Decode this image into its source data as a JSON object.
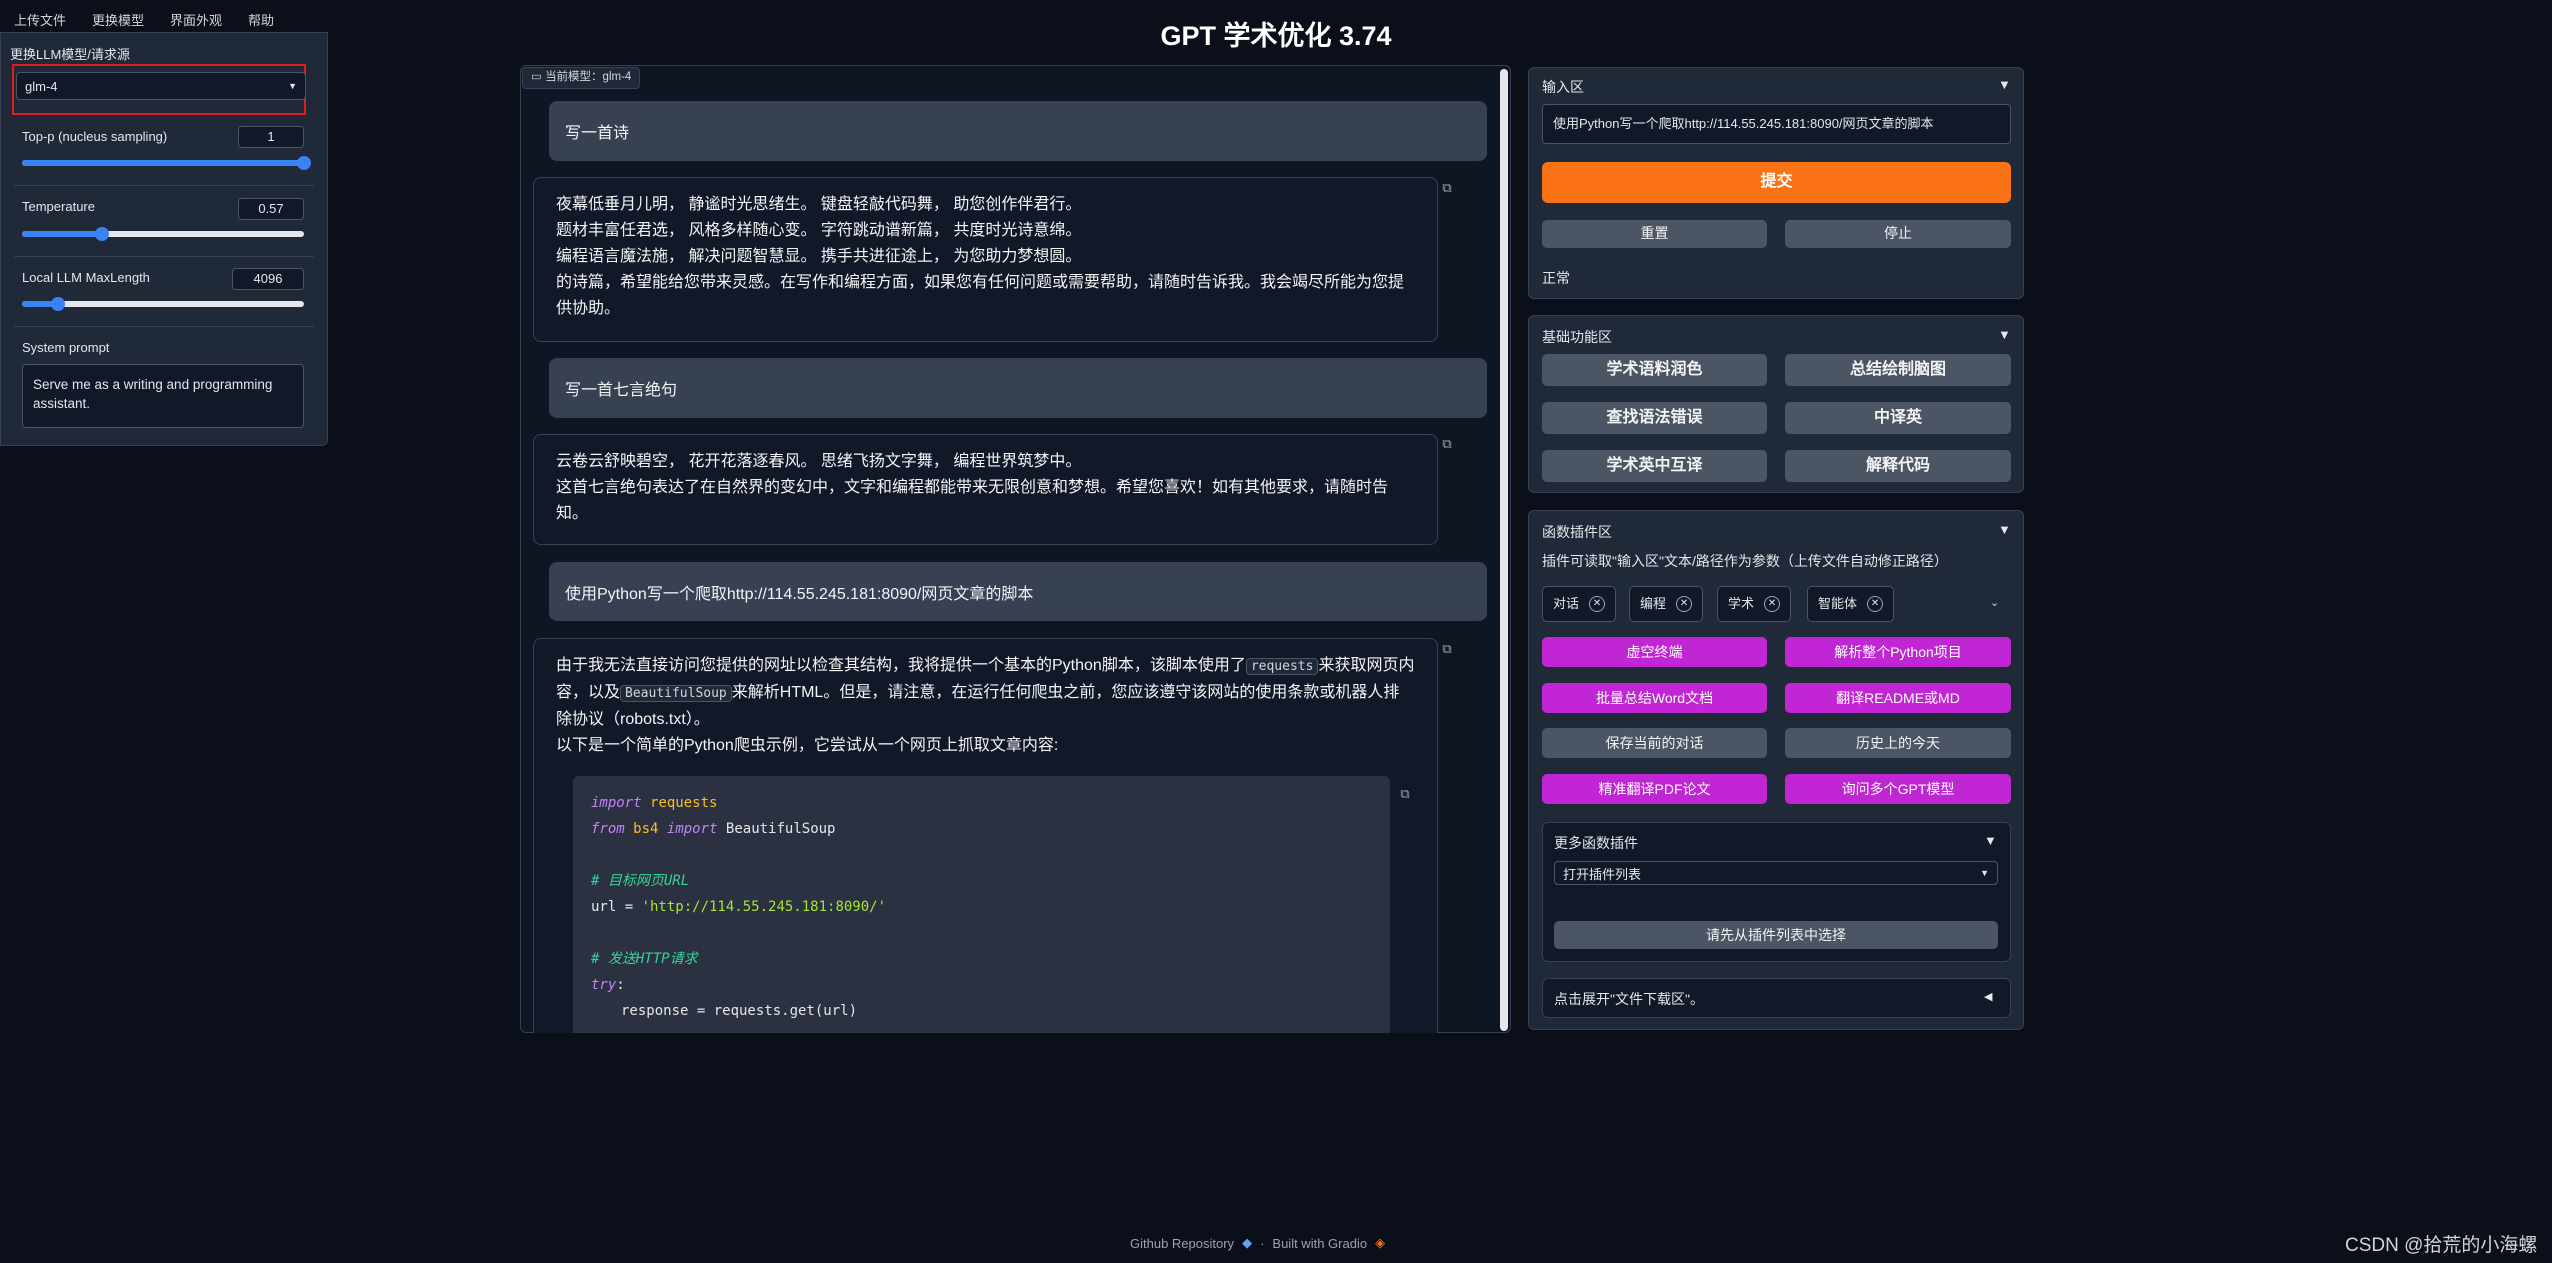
{
  "menu": [
    "上传文件",
    "更换模型",
    "界面外观",
    "帮助"
  ],
  "title": "GPT 学术优化 3.74",
  "left": {
    "model_label": "更换LLM模型/请求源",
    "model_value": "glm-4",
    "top_p": {
      "label": "Top-p (nucleus sampling)",
      "value": "1",
      "fraction": 1.0
    },
    "temperature": {
      "label": "Temperature",
      "value": "0.57",
      "fraction": 0.285
    },
    "maxlength": {
      "label": "Local LLM MaxLength",
      "value": "4096",
      "fraction": 0.128
    },
    "system_prompt_label": "System prompt",
    "system_prompt_value": "Serve me as a writing and programming assistant."
  },
  "chat": {
    "model_tag": "当前模型：glm-4",
    "messages": [
      {
        "role": "user",
        "text": "写一首诗"
      },
      {
        "role": "bot",
        "lines": [
          "夜幕低垂月儿明，  静谧时光思绪生。 键盘轻敲代码舞，  助您创作伴君行。",
          "题材丰富任君选，  风格多样随心变。 字符跳动谱新篇，  共度时光诗意绵。",
          "编程语言魔法施，  解决问题智慧显。 携手共进征途上，  为您助力梦想圆。",
          "的诗篇，希望能给您带来灵感。在写作和编程方面，如果您有任何问题或需要帮助，请随时告诉我。我会竭尽所能为您提供协助。"
        ]
      },
      {
        "role": "user",
        "text": "写一首七言绝句"
      },
      {
        "role": "bot",
        "lines": [
          "云卷云舒映碧空，  花开花落逐春风。 思绪飞扬文字舞，  编程世界筑梦中。",
          "这首七言绝句表达了在自然界的变幻中，文字和编程都能带来无限创意和梦想。希望您喜欢！如有其他要求，请随时告知。"
        ]
      },
      {
        "role": "user",
        "text": "使用Python写一个爬取http://114.55.245.181:8090/网页文章的脚本"
      },
      {
        "role": "bot",
        "p1_a": "由于我无法直接访问您提供的网址以检查其结构，我将提供一个基本的Python脚本，该脚本使用了",
        "code1": "requests",
        "p1_b": "来获取网页内容，以及",
        "code2": "BeautifulSoup",
        "p1_c": "来解析HTML。但是，请注意，在运行任何爬虫之前，您应该遵守该网站的使用条款或机器人排除协议（robots.txt）。",
        "p2": "以下是一个简单的Python爬虫示例，它尝试从一个网页上抓取文章内容:",
        "code": {
          "l1_kw": "import",
          "l1_rest": "requests",
          "l2_kw": "from",
          "l2_mod": "bs4",
          "l2_kw2": "import",
          "l2_rest": "BeautifulSoup",
          "c1": "# 目标网页URL",
          "url_line_a": "url = ",
          "url_line_str": "'http://114.55.245.181:8090/'",
          "c2": "# 发送HTTP请求",
          "try_kw": "try",
          "resp_line": "response = requests.get(url)"
        }
      }
    ]
  },
  "input_box": {
    "title": "输入区",
    "value": "使用Python写一个爬取http://114.55.245.181:8090/网页文章的脚本",
    "submit": "提交",
    "reset": "重置",
    "stop": "停止",
    "status": "正常"
  },
  "basic": {
    "title": "基础功能区",
    "buttons": [
      "学术语料润色",
      "总结绘制脑图",
      "查找语法错误",
      "中译英",
      "学术英中互译",
      "解释代码"
    ]
  },
  "plugins": {
    "title": "函数插件区",
    "hint": "插件可读取\"输入区\"文本/路径作为参数（上传文件自动修正路径）",
    "chips": [
      "对话",
      "编程",
      "学术",
      "智能体"
    ],
    "buttons": [
      "虚空终端",
      "解析整个Python项目",
      "批量总结Word文档",
      "翻译README或MD",
      "保存当前的对话",
      "历史上的今天",
      "精准翻译PDF论文",
      "询问多个GPT模型"
    ],
    "more_title": "更多函数插件",
    "dropdown": "打开插件列表",
    "select_btn": "请先从插件列表中选择",
    "download": "点击展开\"文件下载区\"。"
  },
  "footer": {
    "github": "Github Repository",
    "gradio": "Built with Gradio",
    "watermark": "CSDN @拾荒的小海螺"
  },
  "colors": {
    "accent": "#f97316",
    "plugin": "#c026d3",
    "slider": "#3b82f6",
    "highlight": "#e11d1d"
  }
}
